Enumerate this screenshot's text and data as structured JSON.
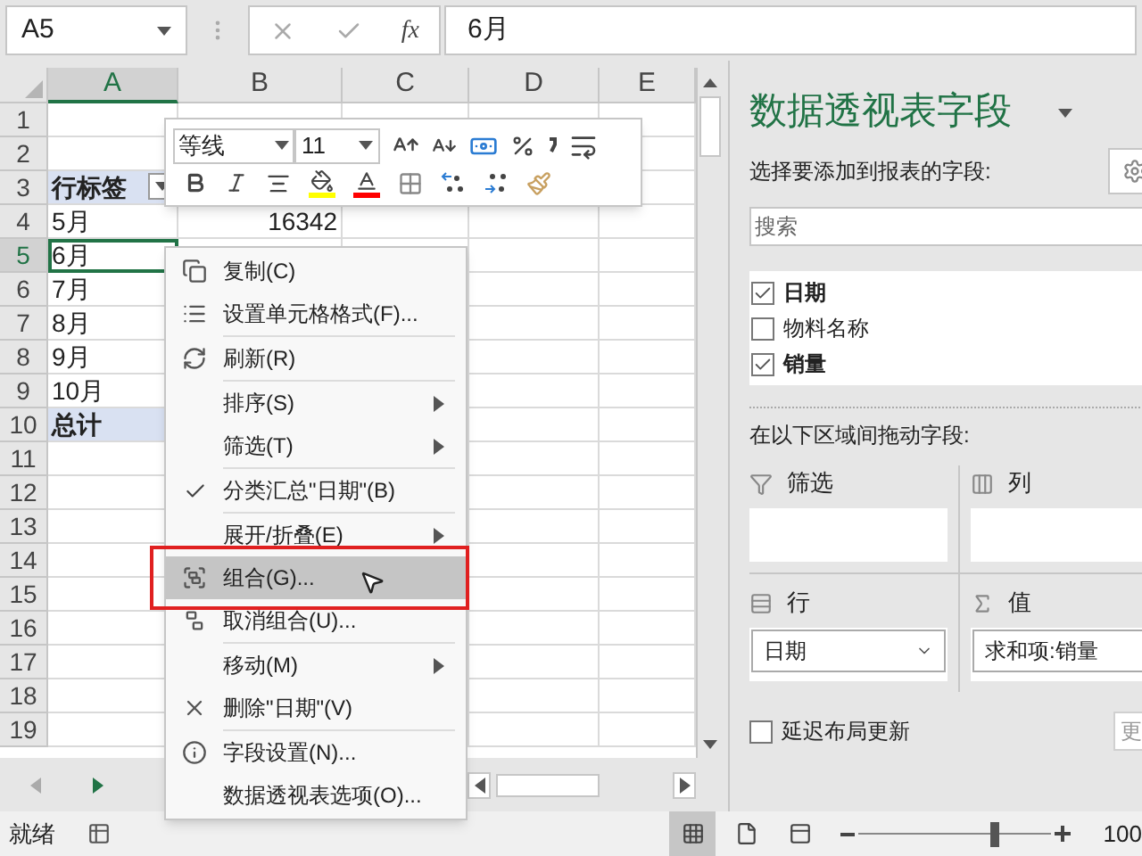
{
  "name_box": {
    "value": "A5"
  },
  "formula_bar": {
    "function_label": "fx",
    "value": "6月"
  },
  "mini_toolbar": {
    "font": "等线",
    "size": "11"
  },
  "sheet": {
    "columns": [
      {
        "label": "A",
        "selected": true
      },
      {
        "label": "B",
        "selected": false
      },
      {
        "label": "C",
        "selected": false
      },
      {
        "label": "D",
        "selected": false
      },
      {
        "label": "E",
        "selected": false
      }
    ],
    "rows": [
      {
        "label": "1",
        "selected": false
      },
      {
        "label": "2",
        "selected": false
      },
      {
        "label": "3",
        "selected": false,
        "a": {
          "text": "行标签",
          "kind": "header",
          "filter_button": true,
          "active": false
        }
      },
      {
        "label": "4",
        "selected": false,
        "a": {
          "text": "5月",
          "kind": "item",
          "active": false
        },
        "b": {
          "text": "16342",
          "kind": "value",
          "active": false
        }
      },
      {
        "label": "5",
        "selected": true,
        "a": {
          "text": "6月",
          "kind": "item",
          "active": true
        }
      },
      {
        "label": "6",
        "selected": false,
        "a": {
          "text": "7月",
          "kind": "item",
          "active": false
        }
      },
      {
        "label": "7",
        "selected": false,
        "a": {
          "text": "8月",
          "kind": "item",
          "active": false
        }
      },
      {
        "label": "8",
        "selected": false,
        "a": {
          "text": "9月",
          "kind": "item",
          "active": false
        }
      },
      {
        "label": "9",
        "selected": false,
        "a": {
          "text": "10月",
          "kind": "item",
          "active": false
        }
      },
      {
        "label": "10",
        "selected": false,
        "a": {
          "text": "总计",
          "kind": "total",
          "active": false
        }
      },
      {
        "label": "11",
        "selected": false
      },
      {
        "label": "12",
        "selected": false
      },
      {
        "label": "13",
        "selected": false
      },
      {
        "label": "14",
        "selected": false
      },
      {
        "label": "15",
        "selected": false
      },
      {
        "label": "16",
        "selected": false
      },
      {
        "label": "17",
        "selected": false
      },
      {
        "label": "18",
        "selected": false
      },
      {
        "label": "19",
        "selected": false
      }
    ]
  },
  "context_menu": [
    {
      "kind": "copy",
      "label": "复制(C)",
      "submenu": false,
      "checked": false,
      "selected": false,
      "annotated": false
    },
    {
      "kind": "format",
      "label": "设置单元格格式(F)...",
      "submenu": false,
      "checked": false,
      "selected": false,
      "annotated": false
    },
    {
      "kind": "separator"
    },
    {
      "kind": "refresh",
      "label": "刷新(R)",
      "submenu": false,
      "checked": false,
      "selected": false,
      "annotated": false
    },
    {
      "kind": "separator"
    },
    {
      "kind": "plain",
      "label": "排序(S)",
      "submenu": true,
      "checked": false,
      "selected": false,
      "annotated": false
    },
    {
      "kind": "plain",
      "label": "筛选(T)",
      "submenu": true,
      "checked": false,
      "selected": false,
      "annotated": false
    },
    {
      "kind": "separator"
    },
    {
      "kind": "plain",
      "label": "分类汇总\"日期\"(B)",
      "submenu": false,
      "checked": true,
      "selected": false,
      "annotated": false
    },
    {
      "kind": "separator"
    },
    {
      "kind": "plain",
      "label": "展开/折叠(E)",
      "submenu": true,
      "checked": false,
      "selected": false,
      "annotated": false
    },
    {
      "kind": "group",
      "label": "组合(G)...",
      "submenu": false,
      "checked": false,
      "selected": true,
      "annotated": true
    },
    {
      "kind": "ungroup",
      "label": "取消组合(U)...",
      "submenu": false,
      "checked": false,
      "selected": false,
      "annotated": false
    },
    {
      "kind": "separator"
    },
    {
      "kind": "plain",
      "label": "移动(M)",
      "submenu": true,
      "checked": false,
      "selected": false,
      "annotated": false
    },
    {
      "kind": "delete",
      "label": "删除\"日期\"(V)",
      "submenu": false,
      "checked": false,
      "selected": false,
      "annotated": false
    },
    {
      "kind": "separator"
    },
    {
      "kind": "info",
      "label": "字段设置(N)...",
      "submenu": false,
      "checked": false,
      "selected": false,
      "annotated": false
    },
    {
      "kind": "plain",
      "label": "数据透视表选项(O)...",
      "submenu": false,
      "checked": false,
      "selected": false,
      "annotated": false
    }
  ],
  "pivot_panel": {
    "title": "数据透视表字段",
    "prompt": "选择要添加到报表的字段:",
    "search": {
      "placeholder": "搜索"
    },
    "fields": [
      {
        "label": "日期",
        "checked": true
      },
      {
        "label": "物料名称",
        "checked": false
      },
      {
        "label": "销量",
        "checked": true
      }
    ],
    "areas_prompt": "在以下区域间拖动字段:",
    "areas": [
      {
        "kind": "filter",
        "label": "筛选"
      },
      {
        "kind": "columns",
        "label": "列"
      },
      {
        "kind": "rows",
        "label": "行",
        "items": [
          "日期"
        ]
      },
      {
        "kind": "values",
        "label": "值",
        "items": [
          "求和项:销量"
        ]
      }
    ],
    "defer_update": {
      "label": "延迟布局更新",
      "checked": false
    },
    "update_button": "更"
  },
  "status_bar": {
    "status": "就绪",
    "views": [
      {
        "kind": "normal",
        "selected": true
      },
      {
        "kind": "page_layout",
        "selected": false
      },
      {
        "kind": "page_break",
        "selected": false
      }
    ],
    "zoom": {
      "level": 0.7
    },
    "zoom_label": "100"
  }
}
